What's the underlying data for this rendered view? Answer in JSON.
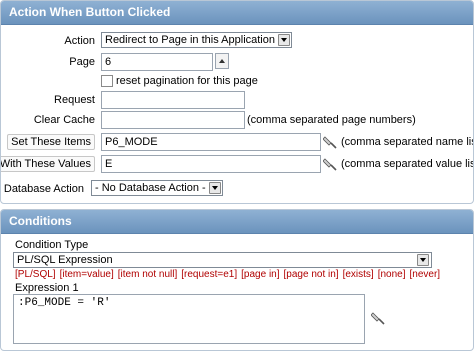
{
  "action_region": {
    "title": "Action When Button Clicked",
    "action": {
      "label": "Action",
      "value": "Redirect to Page in this Application"
    },
    "page": {
      "label": "Page",
      "value": "6"
    },
    "reset_pagination": {
      "label": "reset pagination for this page",
      "checked": false
    },
    "request": {
      "label": "Request",
      "value": ""
    },
    "clear_cache": {
      "label": "Clear Cache",
      "value": "",
      "hint": "(comma separated page numbers)"
    },
    "set_items": {
      "label": "Set These Items",
      "value": "P6_MODE",
      "hint": "(comma separated name list)"
    },
    "with_values": {
      "label": "With These Values",
      "value": "E",
      "hint": "(comma separated value list)"
    },
    "database_action": {
      "label": "Database Action",
      "value": "- No Database Action -"
    }
  },
  "conditions_region": {
    "title": "Conditions",
    "condition_type": {
      "label": "Condition Type",
      "value": "PL/SQL Expression"
    },
    "shortcuts": [
      "[PL/SQL]",
      "[item=value]",
      "[item not null]",
      "[request=e1]",
      "[page in]",
      "[page not in]",
      "[exists]",
      "[none]",
      "[never]"
    ],
    "expression1": {
      "label": "Expression 1",
      "value": ":P6_MODE = 'R'"
    }
  },
  "icons": {
    "picker": "flashlight-icon",
    "dropdown": "chevron-down-icon",
    "spinner": "spin-up-icon"
  }
}
